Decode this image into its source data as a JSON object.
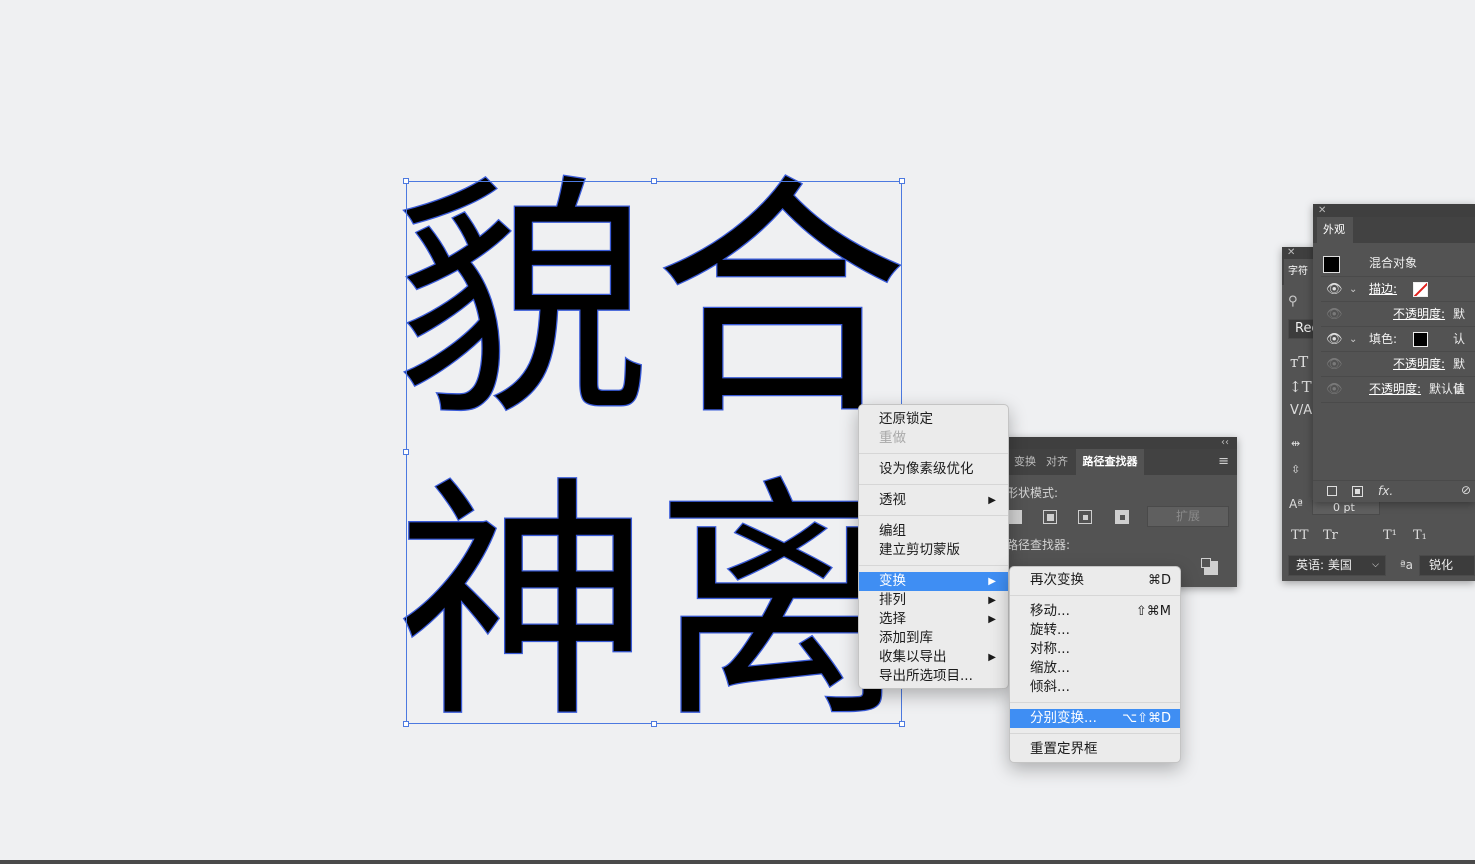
{
  "canvas": {
    "glyphs": [
      "貌",
      "合",
      "神",
      "离"
    ]
  },
  "context_menu": {
    "items": [
      {
        "label": "还原锁定"
      },
      {
        "label": "重做",
        "disabled": true
      },
      {
        "label": "设为像素级优化"
      },
      {
        "label": "透视",
        "submenu": true
      },
      {
        "label": "编组"
      },
      {
        "label": "建立剪切蒙版"
      },
      {
        "label": "变换",
        "submenu": true,
        "highlighted": true
      },
      {
        "label": "排列",
        "submenu": true
      },
      {
        "label": "选择",
        "submenu": true
      },
      {
        "label": "添加到库"
      },
      {
        "label": "收集以导出",
        "submenu": true
      },
      {
        "label": "导出所选项目..."
      }
    ]
  },
  "transform_submenu": {
    "items": [
      {
        "label": "再次变换",
        "shortcut": "⌘D"
      },
      {
        "label": "移动...",
        "shortcut": "⇧⌘M"
      },
      {
        "label": "旋转..."
      },
      {
        "label": "对称..."
      },
      {
        "label": "缩放..."
      },
      {
        "label": "倾斜..."
      },
      {
        "label": "分别变换...",
        "shortcut": "⌥⇧⌘D",
        "highlighted": true
      },
      {
        "label": "重置定界框"
      }
    ]
  },
  "pathfinder_panel": {
    "tabs": [
      "变换",
      "对齐",
      "路径查找器"
    ],
    "active_tab": "路径查找器",
    "shape_modes_label": "形状模式:",
    "expand_label": "扩展",
    "pathfinders_label": "路径查找器:",
    "collapse_glyph": "‹‹",
    "menu_glyph": "≡"
  },
  "character_panel": {
    "tab_label": "字符",
    "font_style_value": "Reg",
    "size_value": "0 pt",
    "language_value": "英语: 美国",
    "antialias_value": "锐化",
    "glyphs": {
      "tt": "TT",
      "tr": "Tr",
      "sup": "T¹",
      "sub": "T₁",
      "aa": "ªa"
    }
  },
  "appearance_panel": {
    "tab_label": "外观",
    "object_label": "混合对象",
    "stroke_label": "描边:",
    "fill_label": "填色:",
    "opacity_label": "不透明度:",
    "opacity_value_short": "默认",
    "opacity_value_full": "默认值",
    "fx_label": "fx."
  },
  "colors": {
    "menu_highlight": "#3f8ef3",
    "selection": "#4c79e0",
    "panel_bg": "#535353"
  }
}
